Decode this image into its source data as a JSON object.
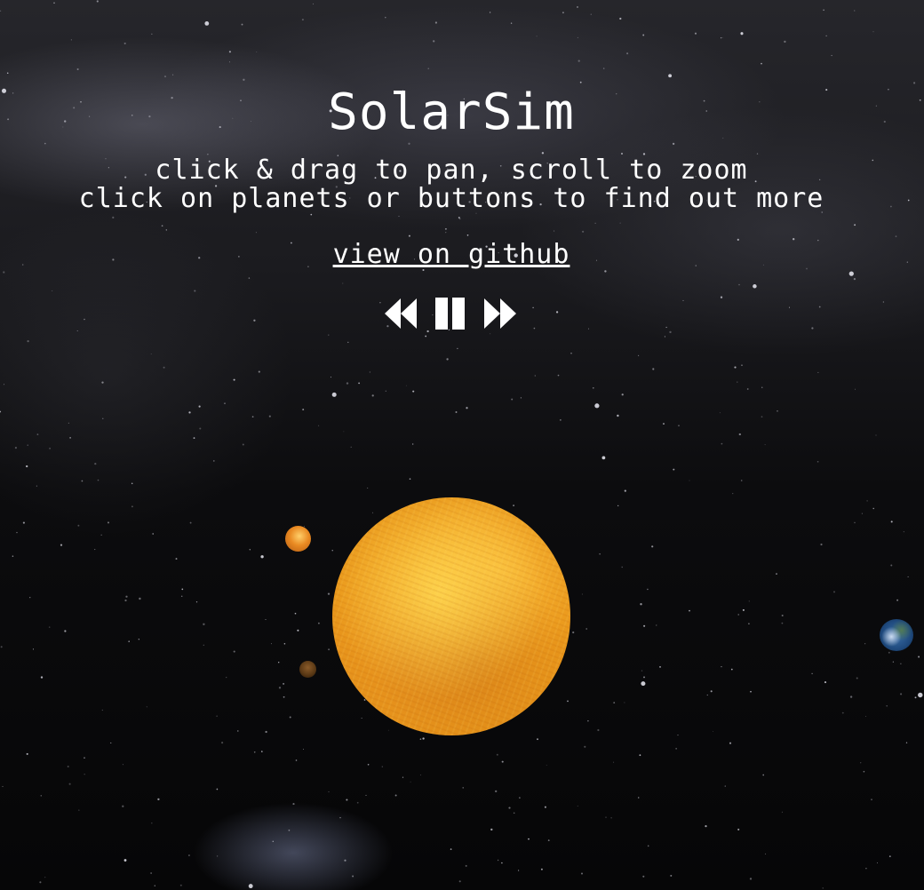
{
  "header": {
    "title": "SolarSim",
    "instruction_line_1": "click & drag to pan, scroll to zoom",
    "instruction_line_2": "click on planets or buttons to find out more",
    "github_link": "view on github"
  },
  "controls": {
    "items": [
      {
        "name": "rewind",
        "icon": "rewind-icon"
      },
      {
        "name": "pause",
        "icon": "pause-icon"
      },
      {
        "name": "fast-forward",
        "icon": "fast-forward-icon"
      }
    ]
  },
  "bodies": [
    {
      "name": "sun",
      "color": "#f0a020"
    },
    {
      "name": "mercury",
      "color": "#e98a22"
    },
    {
      "name": "venus",
      "color": "#5c3a16"
    },
    {
      "name": "earth",
      "color": "#2a5a90"
    }
  ],
  "colors": {
    "text": "#ffffff",
    "background": "#0c0c0e"
  }
}
